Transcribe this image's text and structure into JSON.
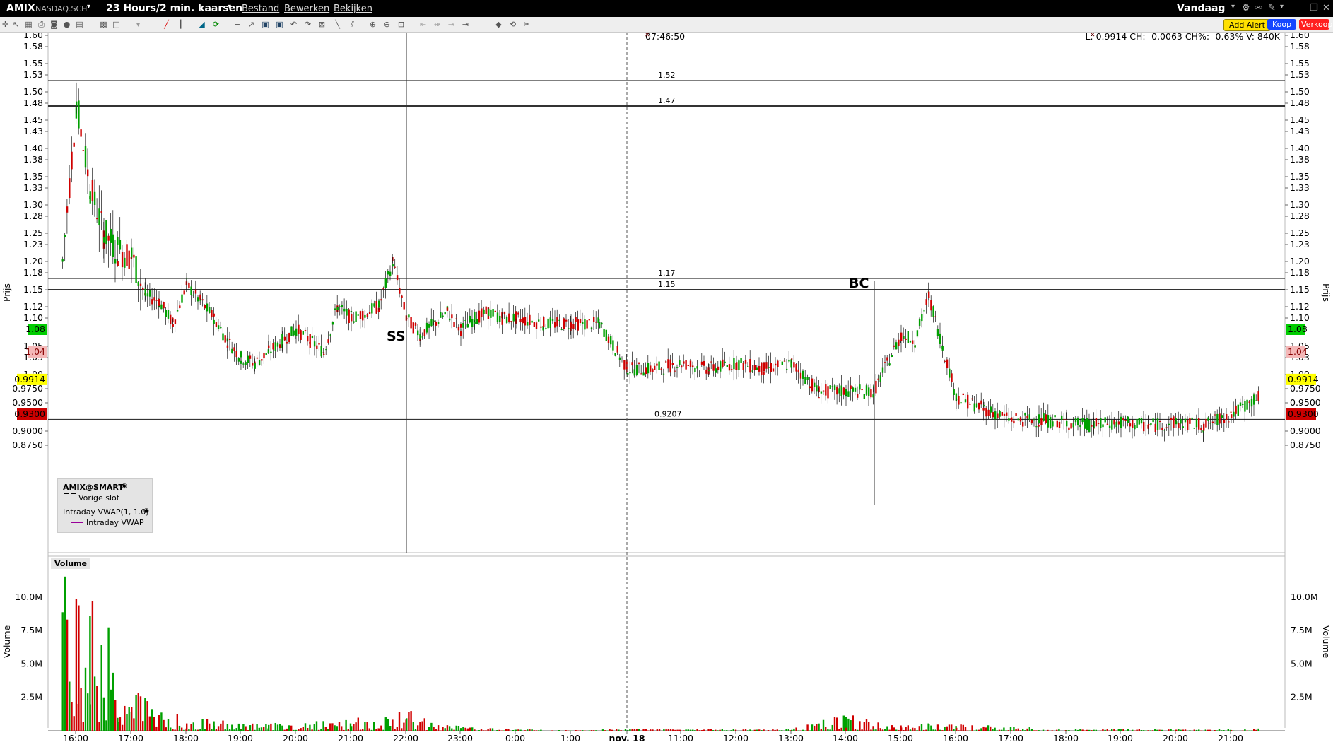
{
  "header": {
    "symbol": "AMIX",
    "exchange": "NASDAQ.SCH",
    "period": "23 Hours/2 min. kaarsen",
    "menu": [
      "Bestand",
      "Bewerken",
      "Bekijken"
    ],
    "range": "Vandaag"
  },
  "toolbar": {
    "add_alert": "Add Alert",
    "buy": "Koop",
    "sell": "Verkoop"
  },
  "readout": {
    "time": "07:46:50",
    "quote": "L: 0.9914 CH: -0.0063 CH%: -0.63% V: 840K"
  },
  "legend": {
    "instrument": "AMIX@SMART",
    "prev_close": "Vorige slot",
    "study": "Intraday VWAP(1, 1.0)",
    "study_series": "Intraday VWAP"
  },
  "annotations": {
    "ss": "SS",
    "bc": "BC"
  },
  "price_axis": {
    "label": "Prijs",
    "ticks": [
      "1.60",
      "1.58",
      "1.55",
      "1.53",
      "1.50",
      "1.48",
      "1.45",
      "1.43",
      "1.40",
      "1.38",
      "1.35",
      "1.33",
      "1.30",
      "1.28",
      "1.25",
      "1.23",
      "1.20",
      "1.18",
      "1.15",
      "1.12",
      "1.10",
      "1.05",
      "1.03",
      "1.00",
      "0.9750",
      "0.9500",
      "0.9000",
      "0.8750"
    ],
    "badges": [
      {
        "text": "1.08",
        "bg": "#00cc00",
        "fg": "#000000"
      },
      {
        "text": "1.04",
        "bg": "#f4b8b8",
        "fg": "#880000"
      },
      {
        "text": "0.9914",
        "bg": "#ffff00",
        "fg": "#000000"
      },
      {
        "text": "0.9300",
        "bg": "#cc0000",
        "fg": "#000000"
      }
    ]
  },
  "level_labels": [
    "1.52",
    "1.47",
    "1.17",
    "1.15",
    "0.9207"
  ],
  "volume_panel": {
    "title": "Volume",
    "axis_label": "Volume",
    "ticks": [
      "10.0M",
      "7.5M",
      "5.0M",
      "2.5M"
    ]
  },
  "time_axis": {
    "ticks": [
      "16:00",
      "17:00",
      "18:00",
      "19:00",
      "20:00",
      "21:00",
      "22:00",
      "23:00",
      "0:00",
      "1:00",
      "nov. 18",
      "11:00",
      "12:00",
      "13:00",
      "14:00",
      "15:00",
      "16:00",
      "17:00",
      "18:00",
      "19:00",
      "20:00",
      "21:00"
    ]
  },
  "colors": {
    "up": "#00a000",
    "down": "#d00000",
    "background": "#ffffff"
  },
  "chart_data": {
    "type": "candlestick",
    "title": "",
    "ylabel": "Prijs",
    "ylim": [
      0.86,
      1.61
    ],
    "volume_ylim": [
      0,
      12.0
    ],
    "volume_unit": "M",
    "horizontal_levels": [
      1.52,
      1.475,
      1.17,
      1.15,
      0.9207
    ],
    "series": [
      {
        "name": "price",
        "x": [
          "15:45",
          "16:00",
          "16:15",
          "16:30",
          "16:45",
          "17:00",
          "17:15",
          "17:30",
          "17:45",
          "18:00",
          "18:15",
          "18:30",
          "18:45",
          "19:00",
          "19:15",
          "19:30",
          "19:45",
          "20:00",
          "20:15",
          "20:30",
          "20:45",
          "21:00",
          "21:15",
          "21:30",
          "21:45",
          "22:00",
          "22:15",
          "22:30",
          "22:45",
          "23:00",
          "23:15",
          "23:30",
          "23:45",
          "0:00",
          "0:30",
          "1:00",
          "1:30",
          "10:00",
          "10:30",
          "11:00",
          "11:30",
          "12:00",
          "12:30",
          "13:00",
          "13:30",
          "14:00",
          "14:30",
          "15:00",
          "15:15",
          "15:30",
          "15:45",
          "16:00",
          "16:30",
          "17:00",
          "17:30",
          "18:00",
          "18:30",
          "19:00",
          "19:30",
          "20:00",
          "20:30",
          "21:00",
          "21:30"
        ],
        "values": [
          1.2,
          1.48,
          1.33,
          1.25,
          1.22,
          1.21,
          1.14,
          1.13,
          1.09,
          1.16,
          1.13,
          1.1,
          1.06,
          1.03,
          1.02,
          1.04,
          1.06,
          1.08,
          1.06,
          1.04,
          1.12,
          1.1,
          1.11,
          1.12,
          1.2,
          1.1,
          1.07,
          1.09,
          1.11,
          1.08,
          1.1,
          1.11,
          1.1,
          1.1,
          1.09,
          1.09,
          1.09,
          1.01,
          1.01,
          1.02,
          1.01,
          1.02,
          1.01,
          1.02,
          0.97,
          0.97,
          0.97,
          1.07,
          1.06,
          1.14,
          1.05,
          0.96,
          0.94,
          0.92,
          0.92,
          0.915,
          0.91,
          0.915,
          0.91,
          0.915,
          0.91,
          0.93,
          0.96
        ]
      },
      {
        "name": "volume",
        "x": [
          "15:45",
          "16:00",
          "16:15",
          "16:30",
          "16:45",
          "17:00",
          "17:30",
          "18:00",
          "18:30",
          "19:00",
          "19:30",
          "20:00",
          "21:00",
          "21:30",
          "22:00",
          "22:30",
          "23:00",
          "0:00",
          "1:00",
          "10:00",
          "11:00",
          "12:00",
          "13:00",
          "14:00",
          "14:30",
          "15:00",
          "15:30",
          "16:00",
          "17:00",
          "18:00",
          "19:00",
          "20:00",
          "21:00",
          "21:30"
        ],
        "values": [
          11.5,
          9.5,
          8.5,
          7.0,
          6.0,
          3.0,
          1.5,
          0.9,
          0.8,
          0.6,
          0.5,
          0.5,
          0.8,
          0.9,
          1.4,
          0.5,
          0.3,
          0.1,
          0.05,
          0.15,
          0.1,
          0.1,
          0.12,
          1.1,
          0.6,
          0.35,
          0.5,
          0.4,
          0.3,
          0.15,
          0.12,
          0.1,
          0.1,
          0.2
        ]
      }
    ]
  }
}
